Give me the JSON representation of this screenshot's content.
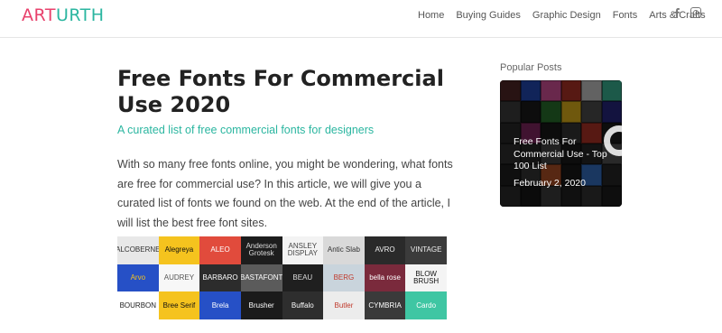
{
  "header": {
    "logo_part1": "ART",
    "logo_part2": "URTH",
    "nav": [
      "Home",
      "Buying Guides",
      "Graphic Design",
      "Fonts",
      "Arts & Crafts"
    ],
    "social": [
      "facebook-icon",
      "instagram-icon"
    ]
  },
  "article": {
    "title": "Free Fonts For Commercial Use 2020",
    "subtitle": "A curated list of free commercial fonts for designers",
    "intro": "With so many free fonts online, you might be wondering, what fonts are free for commercial use? In this article, we will give you a curated list of fonts we found on the web. At the end of the article, I will list the best free font sites."
  },
  "font_grid": [
    {
      "label": "ALCOBERNE",
      "bg": "#e8e8e8",
      "fg": "#333"
    },
    {
      "label": "Alegreya",
      "bg": "#f5c31e",
      "fg": "#111"
    },
    {
      "label": "ALEO",
      "bg": "#e14b3c",
      "fg": "#fff"
    },
    {
      "label": "Anderson Grotesk",
      "bg": "#1d1d1d",
      "fg": "#ddd"
    },
    {
      "label": "ANSLEY DISPLAY",
      "bg": "#f3f3f3",
      "fg": "#444"
    },
    {
      "label": "Antic Slab",
      "bg": "#d9d9d9",
      "fg": "#333"
    },
    {
      "label": "AVRO",
      "bg": "#2a2a2a",
      "fg": "#eee"
    },
    {
      "label": "VINTAGE",
      "bg": "#3b3b3b",
      "fg": "#eee"
    },
    {
      "label": "Arvo",
      "bg": "#2650c6",
      "fg": "#f5c31e"
    },
    {
      "label": "AUDREY",
      "bg": "#f7f7f7",
      "fg": "#555"
    },
    {
      "label": "BARBARO",
      "bg": "#2c2c2c",
      "fg": "#fff"
    },
    {
      "label": "BASTAFONT",
      "bg": "#5b5b5b",
      "fg": "#fff"
    },
    {
      "label": "BEAU",
      "bg": "#1f1f1f",
      "fg": "#ddd"
    },
    {
      "label": "BERG",
      "bg": "#c9d4dc",
      "fg": "#c0392b"
    },
    {
      "label": "bella rose",
      "bg": "#7a2a3c",
      "fg": "#fff"
    },
    {
      "label": "BLOW BRUSH",
      "bg": "#f4f4f4",
      "fg": "#111"
    },
    {
      "label": "BOURBON",
      "bg": "#ffffff",
      "fg": "#222"
    },
    {
      "label": "Bree Serif",
      "bg": "#f5c31e",
      "fg": "#111"
    },
    {
      "label": "Brela",
      "bg": "#2650c6",
      "fg": "#fff"
    },
    {
      "label": "Brusher",
      "bg": "#1b1b1b",
      "fg": "#fff"
    },
    {
      "label": "Buffalo",
      "bg": "#2e2e2e",
      "fg": "#fff"
    },
    {
      "label": "Butler",
      "bg": "#ececec",
      "fg": "#c0392b"
    },
    {
      "label": "CYMBRIA",
      "bg": "#3a3a3a",
      "fg": "#fff"
    },
    {
      "label": "Cardo",
      "bg": "#3fc6a3",
      "fg": "#fff"
    }
  ],
  "sidebar": {
    "heading": "Popular Posts",
    "post_title": "Free Fonts For Commercial Use - Top 100 List",
    "post_date": "February 2, 2020",
    "card_tiles": [
      "#5a2a2a",
      "#2650c6",
      "#e85aa8",
      "#c0392b",
      "#d9d9d9",
      "#3fc6a3",
      "#444",
      "#1d1d1d",
      "#2e7d32",
      "#f5c31e",
      "#555",
      "#2b2b8c",
      "#2d2d2d",
      "#8e2b6a",
      "#1b1b1b",
      "#3a3a3a",
      "#c0392b",
      "#1f1f1f",
      "#333",
      "#2a2a2a",
      "#4a4a4a",
      "#1d1d1d",
      "#2c2c2c",
      "#5b5b5b",
      "#222",
      "#3b3b3b",
      "#c25a2a",
      "#1b1b1b",
      "#3a7bd5",
      "#2b2b2b",
      "#303030",
      "#1a1a1a",
      "#444",
      "#252525",
      "#383838",
      "#1f1f1f"
    ]
  }
}
